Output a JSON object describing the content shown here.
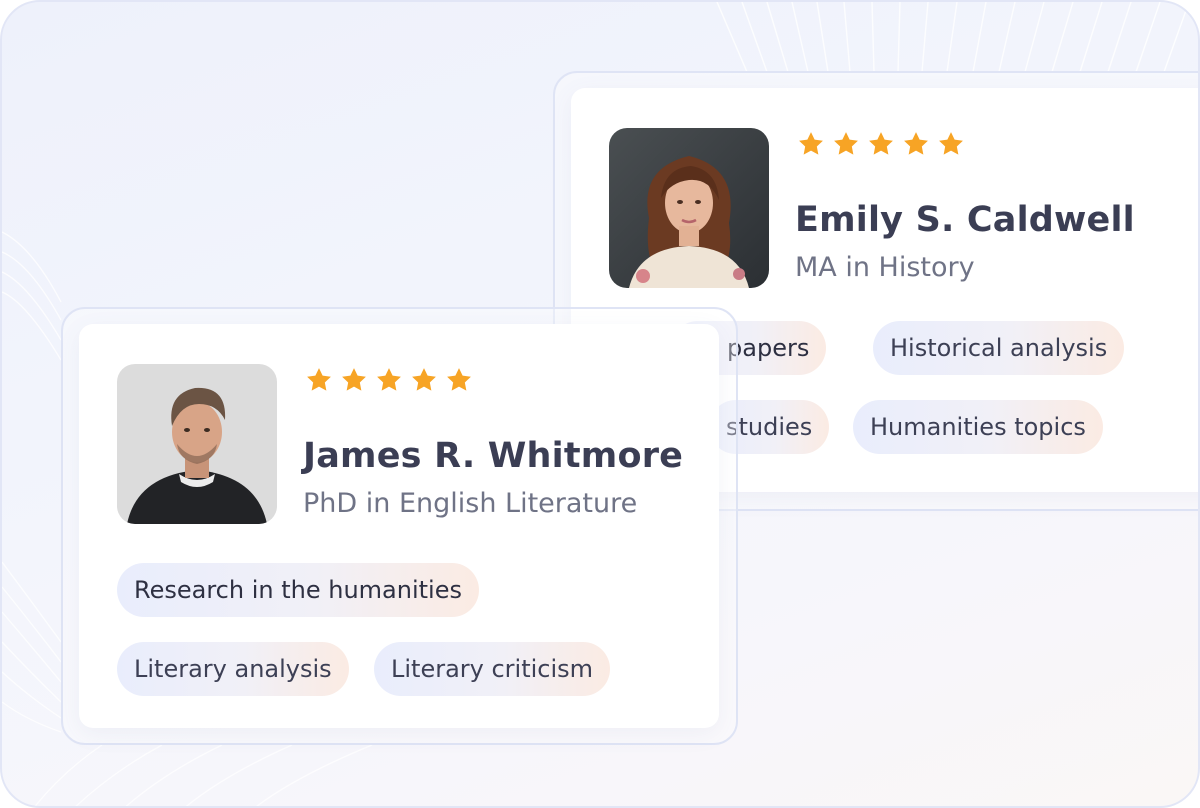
{
  "colors": {
    "star": "#f7a425",
    "name_text": "#3b3e54",
    "degree_text": "#6f7386",
    "tag_start": "#e9edfc",
    "tag_end": "#fbebe3"
  },
  "cards": {
    "back": {
      "rating_out_of_5": 5,
      "name": "Emily S. Caldwell",
      "degree": "MA in History",
      "tags": [
        "ch papers",
        "Historical analysis",
        "studies",
        "Humanities topics"
      ],
      "avatar_icon": "woman-portrait-photo"
    },
    "front": {
      "rating_out_of_5": 5,
      "name": "James R. Whitmore",
      "degree": "PhD in English Literature",
      "tags": [
        "Research in the humanities",
        "Literary analysis",
        "Literary criticism"
      ],
      "avatar_icon": "man-portrait-photo"
    }
  }
}
